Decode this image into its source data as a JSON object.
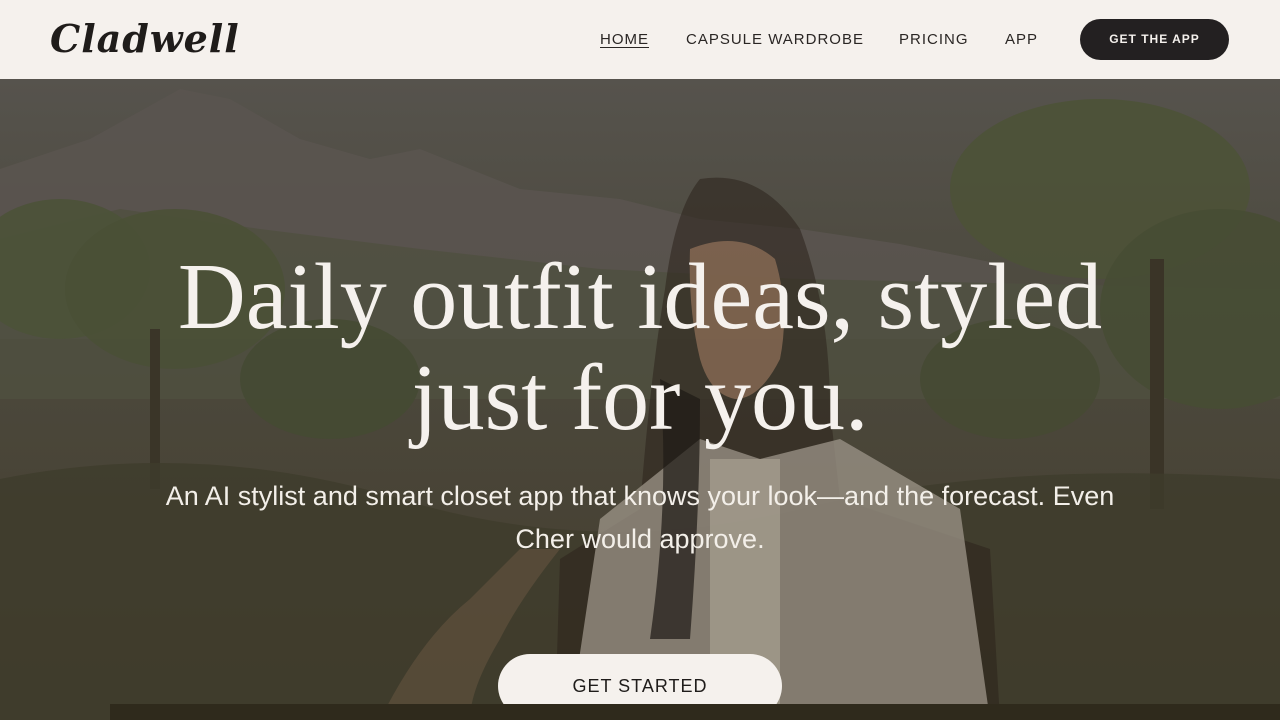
{
  "header": {
    "logo": "Cladwell",
    "nav": [
      {
        "label": "HOME",
        "active": true
      },
      {
        "label": "CAPSULE WARDROBE",
        "active": false
      },
      {
        "label": "PRICING",
        "active": false
      },
      {
        "label": "APP",
        "active": false
      }
    ],
    "cta_label": "GET THE APP"
  },
  "hero": {
    "title_line1": "Daily outfit ideas, styled",
    "title_line2": "just for you.",
    "subtitle_line1": "An AI stylist and smart closet app that knows your look—and the forecast. Even",
    "subtitle_line2": "Cher would approve.",
    "cta_label": "GET STARTED"
  },
  "colors": {
    "header_bg": "#f5f1ed",
    "ink": "#1f1c1a",
    "button_dark": "#232021",
    "hero_text": "#f5f1ed"
  }
}
